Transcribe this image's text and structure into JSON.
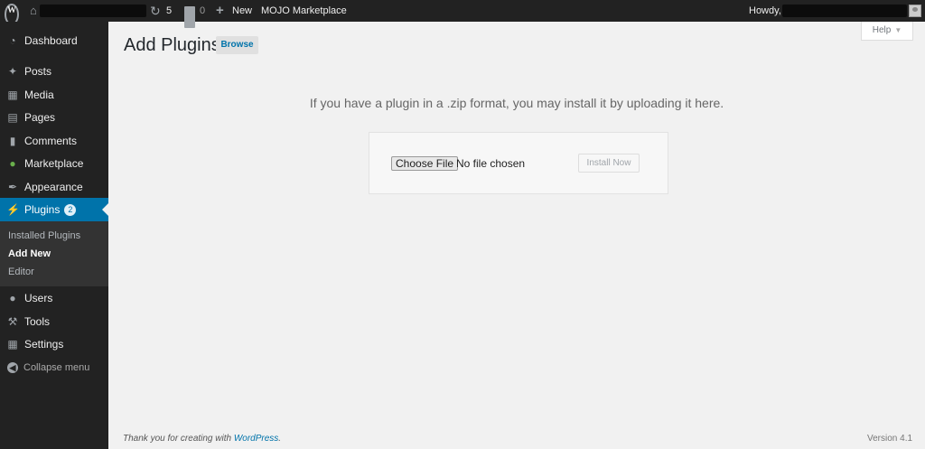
{
  "admin_bar": {
    "update_count": "5",
    "comment_count": "0",
    "new_label": "New",
    "marketplace_label": "MOJO Marketplace",
    "howdy_label": "Howdy,"
  },
  "sidebar": {
    "items": [
      {
        "label": "Dashboard",
        "icon": "dashboard-icon"
      },
      {
        "label": "Posts",
        "icon": "pin-icon"
      },
      {
        "label": "Media",
        "icon": "media-icon"
      },
      {
        "label": "Pages",
        "icon": "pages-icon"
      },
      {
        "label": "Comments",
        "icon": "comments-icon"
      },
      {
        "label": "Marketplace",
        "icon": "marketplace-icon"
      },
      {
        "label": "Appearance",
        "icon": "paintbrush-icon"
      },
      {
        "label": "Plugins",
        "icon": "plug-icon",
        "badge": "2"
      },
      {
        "label": "Users",
        "icon": "users-icon"
      },
      {
        "label": "Tools",
        "icon": "wrench-icon"
      },
      {
        "label": "Settings",
        "icon": "settings-icon"
      }
    ],
    "submenu": [
      "Installed Plugins",
      "Add New",
      "Editor"
    ],
    "collapse_label": "Collapse menu"
  },
  "header": {
    "title": "Add Plugins",
    "browse_label": "Browse",
    "help_label": "Help"
  },
  "upload": {
    "description": "If you have a plugin in a .zip format, you may install it by uploading it here.",
    "choose_file_label": "Choose File",
    "no_file_label": "No file chosen",
    "install_label": "Install Now"
  },
  "footer": {
    "thanks_prefix": "Thank you for creating with ",
    "thanks_link": "WordPress",
    "thanks_suffix": ".",
    "version": "Version 4.1"
  },
  "colors": {
    "admin_bar": "#222222",
    "sidebar": "#222222",
    "accent": "#0073aa",
    "background": "#f1f1f1"
  }
}
